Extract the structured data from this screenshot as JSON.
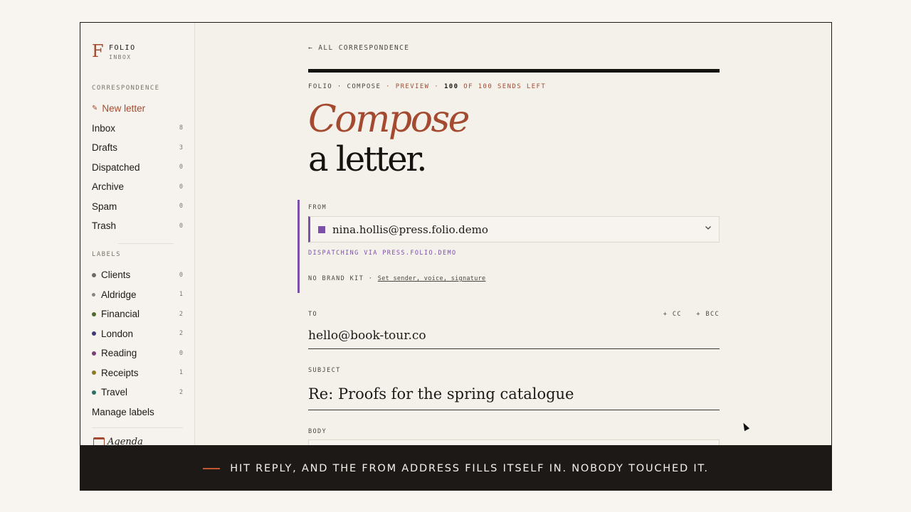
{
  "sidebar": {
    "brand_mark": "F",
    "brand_name": "FOLIO",
    "brand_sub": "INBOX",
    "correspondence_title": "CORRESPONDENCE",
    "new_letter": "New letter",
    "folders": [
      {
        "label": "Inbox",
        "count": "8"
      },
      {
        "label": "Drafts",
        "count": "3"
      },
      {
        "label": "Dispatched",
        "count": "0"
      },
      {
        "label": "Archive",
        "count": "0"
      },
      {
        "label": "Spam",
        "count": "0"
      },
      {
        "label": "Trash",
        "count": "0"
      }
    ],
    "labels_title": "LABELS",
    "labels": [
      {
        "label": "Clients",
        "count": "0",
        "color": "#6e6a64"
      },
      {
        "label": "Aldridge",
        "count": "1",
        "color": "#8a857e"
      },
      {
        "label": "Financial",
        "count": "2",
        "color": "#4f6b2a"
      },
      {
        "label": "London",
        "count": "2",
        "color": "#3f3a78"
      },
      {
        "label": "Reading",
        "count": "0",
        "color": "#7a3f78"
      },
      {
        "label": "Receipts",
        "count": "1",
        "color": "#8a7a2a"
      },
      {
        "label": "Travel",
        "count": "2",
        "color": "#2a6f6a"
      }
    ],
    "manage_labels": "Manage labels",
    "agenda": "Agenda"
  },
  "main": {
    "back_link": "← ALL CORRESPONDENCE",
    "meta": {
      "prefix": "FOLIO · COMPOSE",
      "preview": "· PREVIEW ·",
      "sends": "100",
      "sends_suffix": "OF 100 SENDS LEFT"
    },
    "heading_italic": "Compose",
    "heading_plain": "a letter.",
    "from": {
      "label": "FROM",
      "value": "nina.hollis@press.folio.demo",
      "via": "DISPATCHING VIA PRESS.FOLIO.DEMO",
      "brand_kit": "NO BRAND KIT ·",
      "brand_kit_link": "Set sender, voice, signature"
    },
    "to": {
      "label": "TO",
      "cc": "+ CC",
      "bcc": "+ BCC",
      "value": "hello@book-tour.co"
    },
    "subject": {
      "label": "SUBJECT",
      "value": "Re: Proofs for the spring catalogue"
    },
    "body": {
      "label": "BODY"
    }
  },
  "caption": "HIT REPLY, AND THE FROM ADDRESS FILLS ITSELF IN. NOBODY TOUCHED IT.",
  "colors": {
    "accent": "#a44a30",
    "sender": "#7c4fa8"
  }
}
